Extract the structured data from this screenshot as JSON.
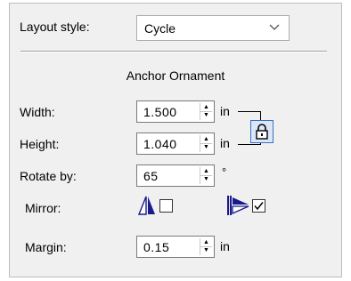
{
  "layout": {
    "label": "Layout style:",
    "value": "Cycle"
  },
  "section_title": "Anchor Ornament",
  "width": {
    "label": "Width:",
    "value": "1.500",
    "unit": "in"
  },
  "height": {
    "label": "Height:",
    "value": "1.040",
    "unit": "in"
  },
  "rotate": {
    "label": "Rotate by:",
    "value": "65",
    "unit": "°"
  },
  "mirror": {
    "label": "Mirror:",
    "horizontal_checked": false,
    "vertical_checked": true
  },
  "margin": {
    "label": "Margin:",
    "value": "0.15",
    "unit": "in"
  },
  "colors": {
    "panel_bg": "#f0f0f0",
    "accent": "#1a1a8c",
    "lock_border": "#3b6fc4"
  },
  "icons": [
    "chevron-down-icon",
    "spin-up-icon",
    "spin-down-icon",
    "lock-icon",
    "flip-horizontal-icon",
    "flip-vertical-icon"
  ]
}
